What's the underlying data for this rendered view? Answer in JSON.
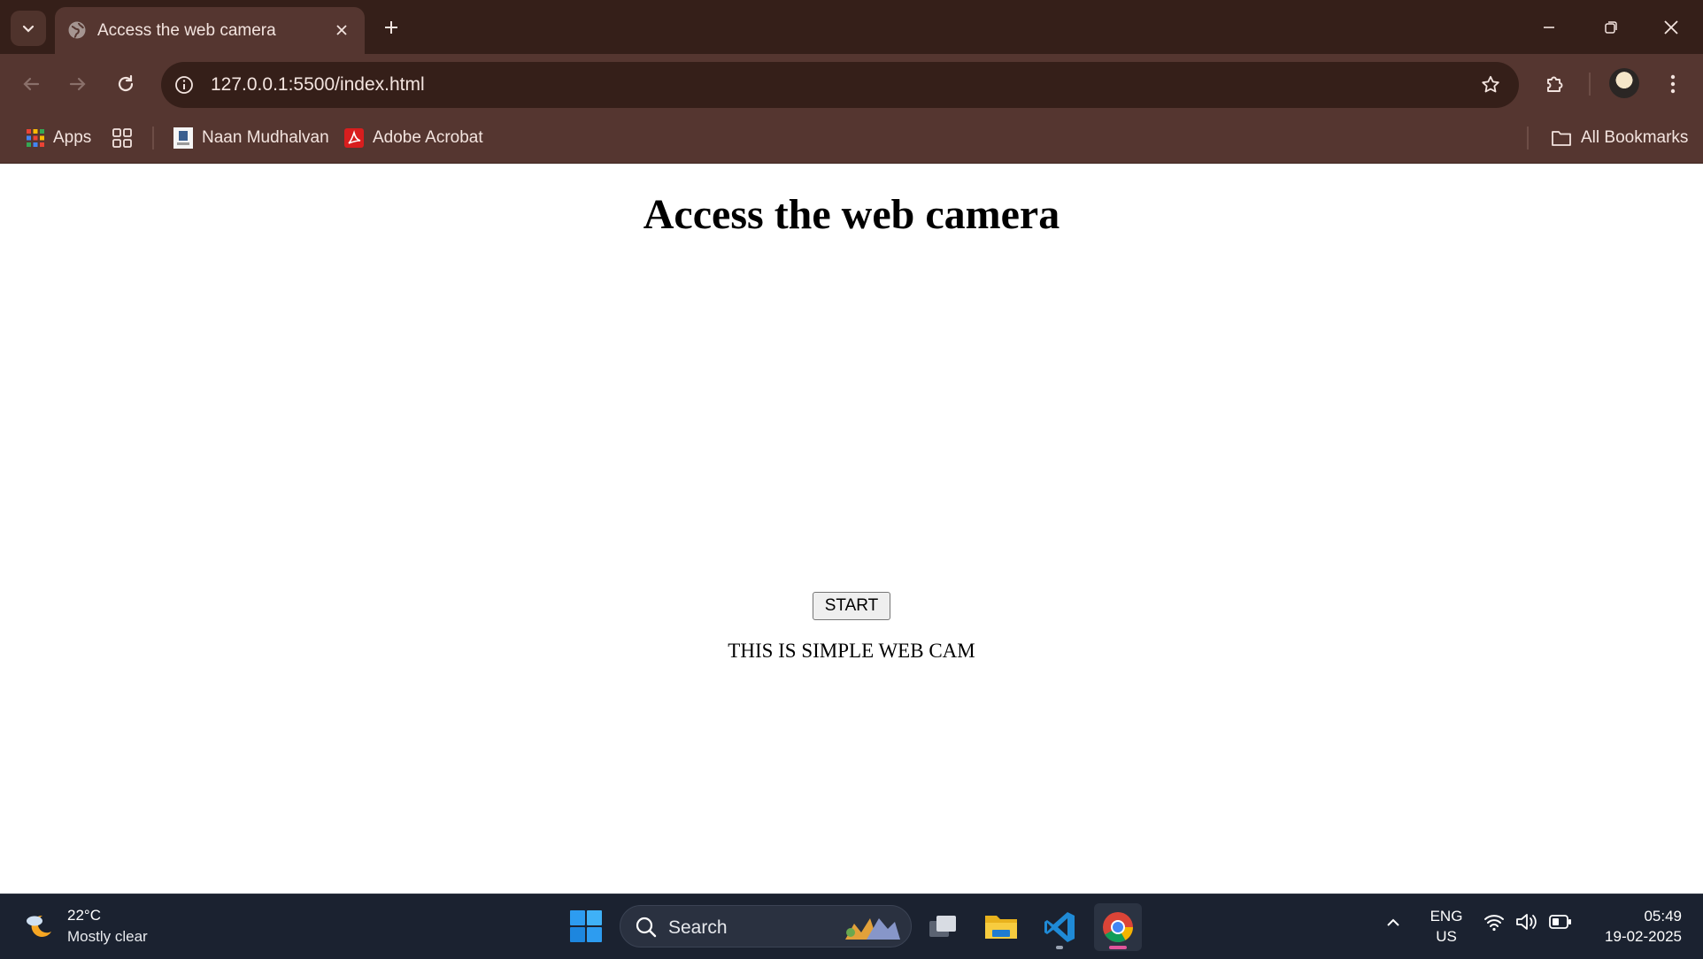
{
  "browser": {
    "tab": {
      "title": "Access the web camera"
    },
    "address": {
      "url": "127.0.0.1:5500/index.html"
    },
    "bookmarks": [
      {
        "label": "Apps"
      },
      {
        "label": "Naan Mudhalvan"
      },
      {
        "label": "Adobe Acrobat"
      }
    ],
    "all_bookmarks_label": "All Bookmarks"
  },
  "page": {
    "heading": "Access the web camera",
    "start_button_label": "START",
    "caption": "THIS IS SIMPLE WEB CAM"
  },
  "taskbar": {
    "weather": {
      "temperature": "22°C",
      "condition": "Mostly clear"
    },
    "search_label": "Search",
    "language": {
      "lang": "ENG",
      "region": "US"
    },
    "clock": {
      "time": "05:49",
      "date": "19-02-2025"
    }
  },
  "colors": {
    "tabstrip": "#351f19",
    "toolbar": "#553630",
    "taskbar": "#1b2230",
    "accent_indicator": "#e0559b"
  }
}
